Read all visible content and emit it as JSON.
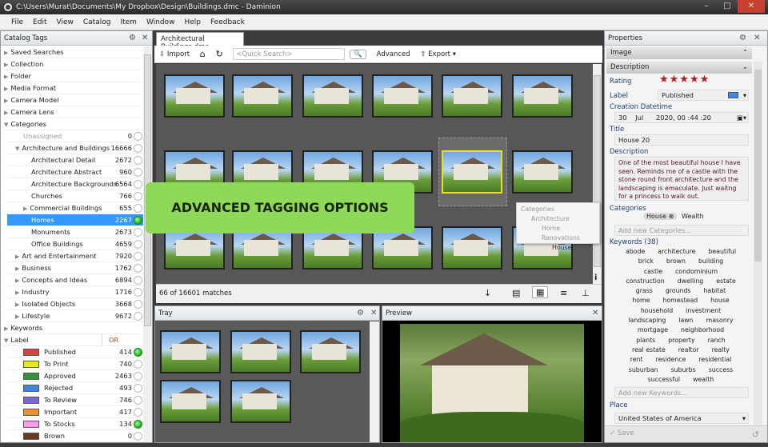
{
  "window": {
    "title": "C:\\Users\\Murat\\Documents\\My Dropbox\\Design\\Buildings.dmc - Daminion",
    "min": "–",
    "max": "□",
    "close": "✕"
  },
  "menu": [
    "File",
    "Edit",
    "View",
    "Catalog",
    "Item",
    "Window",
    "Help",
    "Feedback"
  ],
  "catalog_tags": {
    "title": "Catalog Tags",
    "top": [
      "Saved Searches",
      "Collection",
      "Folder",
      "Media Format",
      "Camera Model",
      "Camera Lens",
      "Categories"
    ],
    "categories": [
      {
        "label": "Unassigned",
        "count": "0",
        "level": 1,
        "muted": true
      },
      {
        "label": "Architecture and Buildings",
        "count": "16666",
        "level": 1,
        "expanded": true
      },
      {
        "label": "Architectural Detail",
        "count": "2672",
        "level": 2
      },
      {
        "label": "Architecture Abstract",
        "count": "960",
        "level": 2
      },
      {
        "label": "Architecture Backgrounds",
        "count": "6564",
        "level": 2
      },
      {
        "label": "Churches",
        "count": "766",
        "level": 2
      },
      {
        "label": "Commercial Buildings",
        "count": "655",
        "level": 2,
        "collapsed": true
      },
      {
        "label": "Homes",
        "count": "2267",
        "level": 2,
        "selected": true,
        "checked": true
      },
      {
        "label": "Monuments",
        "count": "2673",
        "level": 2
      },
      {
        "label": "Office Buildings",
        "count": "4659",
        "level": 2
      },
      {
        "label": "Art and Entertainment",
        "count": "7920",
        "level": 1,
        "collapsed": true
      },
      {
        "label": "Business",
        "count": "1762",
        "level": 1,
        "collapsed": true
      },
      {
        "label": "Concepts and Ideas",
        "count": "6894",
        "level": 1,
        "collapsed": true
      },
      {
        "label": "Industry",
        "count": "1716",
        "level": 1,
        "collapsed": true
      },
      {
        "label": "Isolated Objects",
        "count": "3668",
        "level": 1,
        "collapsed": true
      },
      {
        "label": "Lifestyle",
        "count": "9672",
        "level": 1,
        "collapsed": true
      }
    ],
    "keywords": "Keywords",
    "label_header": "Label",
    "or_label": "OR",
    "labels": [
      {
        "label": "Published",
        "count": "414",
        "color": "#d94040",
        "checked": true
      },
      {
        "label": "To Print",
        "count": "740",
        "color": "#e8e830"
      },
      {
        "label": "Approved",
        "count": "2463",
        "color": "#3a8f3a"
      },
      {
        "label": "Rejected",
        "count": "493",
        "color": "#3a86e0"
      },
      {
        "label": "To Review",
        "count": "746",
        "color": "#7a68d8"
      },
      {
        "label": "Important",
        "count": "417",
        "color": "#e8923a"
      },
      {
        "label": "To Stocks",
        "count": "134",
        "color": "#ff9af0",
        "checked": true
      },
      {
        "label": "Brown",
        "count": "0",
        "color": "#6b3a1e"
      }
    ]
  },
  "doc_tab": "Architectural Buildings.dmc",
  "toolbar": {
    "import": "Import",
    "search_placeholder": "<Quick Search>",
    "advanced": "Advanced",
    "export": "Export"
  },
  "browser": {
    "status": "66 of 16601 matches"
  },
  "banner": "ADVANCED TAGGING OPTIONS",
  "tooltip": {
    "lines": [
      "Categories",
      "Architecture",
      "Home Renovations",
      "House"
    ]
  },
  "tray": {
    "title": "Tray"
  },
  "preview": {
    "title": "Preview"
  },
  "properties": {
    "title": "Properties",
    "section_image": "Image",
    "section_description": "Description",
    "rating_label": "Rating",
    "rating": 5,
    "rating_max": 5,
    "label_label": "Label",
    "label_value": "Published",
    "label_color": "#3a86e0",
    "datetime_label": "Creation Datetime",
    "day": "30",
    "month": "Jul",
    "year_time": "2020, 00 :44 :20",
    "title_label": "Title",
    "title_value": "House 20",
    "description_label": "Description",
    "description_value": "One of the most beautiful house I have seen. Reminds me of a castle with the stone round front architecture and the landscaping is emaculate. Just waitng for a princess to walk out.",
    "categories_label": "Categories",
    "categories": [
      "House",
      "Wealth"
    ],
    "categories_placeholder": "Add new Categories...",
    "keywords_label": "Keywords (38)",
    "keywords": [
      [
        "abode",
        "architecture",
        "beautiful"
      ],
      [
        "brick",
        "brown",
        "building"
      ],
      [
        "castle",
        "condominium"
      ],
      [
        "construction",
        "dwelling",
        "estate"
      ],
      [
        "grass",
        "grounds",
        "habitat"
      ],
      [
        "home",
        "homestead",
        "house"
      ],
      [
        "household",
        "investment"
      ],
      [
        "landscaping",
        "lawn",
        "masonry"
      ],
      [
        "mortgage",
        "neighborhood"
      ],
      [
        "plants",
        "property",
        "ranch"
      ],
      [
        "real estate",
        "realtor",
        "realty"
      ],
      [
        "rent",
        "residence",
        "residential"
      ],
      [
        "suburban",
        "suburbs",
        "success"
      ],
      [
        "successful",
        "wealth"
      ]
    ],
    "keywords_placeholder": "Add new Keywords...",
    "place_label": "Place",
    "place_value": "United States of America",
    "save": "Save"
  },
  "accent": "#3399ff",
  "banner_color": "#8ed85a"
}
